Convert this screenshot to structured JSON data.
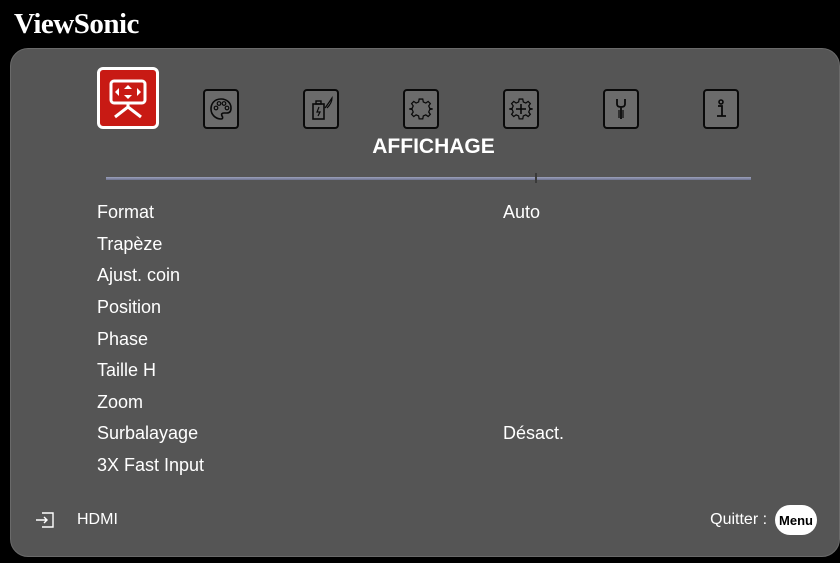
{
  "brand": {
    "name": "ViewSonic"
  },
  "tabs": [
    {
      "icon": "display-icon",
      "active": true
    },
    {
      "icon": "palette-icon",
      "active": false
    },
    {
      "icon": "power-settings-icon",
      "active": false
    },
    {
      "icon": "gear-icon",
      "active": false
    },
    {
      "icon": "advanced-gear-icon",
      "active": false
    },
    {
      "icon": "wrench-icon",
      "active": false
    },
    {
      "icon": "info-icon",
      "active": false
    }
  ],
  "section": {
    "title": "AFFICHAGE"
  },
  "menu": {
    "items": [
      {
        "label": "Format",
        "value": "Auto"
      },
      {
        "label": "Trapèze",
        "value": ""
      },
      {
        "label": "Ajust. coin",
        "value": ""
      },
      {
        "label": "Position",
        "value": ""
      },
      {
        "label": "Phase",
        "value": ""
      },
      {
        "label": "Taille H",
        "value": ""
      },
      {
        "label": "Zoom",
        "value": ""
      },
      {
        "label": "Surbalayage",
        "value": "Désact."
      },
      {
        "label": "3X Fast Input",
        "value": ""
      }
    ]
  },
  "footer": {
    "source_label": "HDMI",
    "exit_label": "Quitter :",
    "menu_key": "Menu"
  },
  "colors": {
    "panel": "#555555",
    "active_tab": "#c81a14",
    "text": "#ffffff"
  }
}
